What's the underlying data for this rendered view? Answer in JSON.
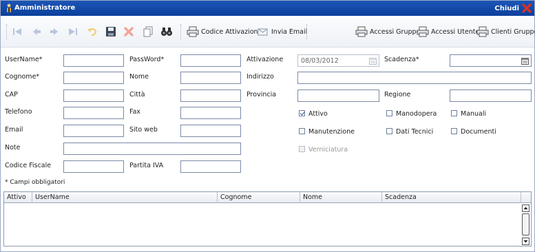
{
  "window": {
    "title": "Amministratore",
    "close_label": "Chiudi"
  },
  "toolbar": {
    "buttons": [
      {
        "icon": "first-record-icon"
      },
      {
        "icon": "previous-record-icon"
      },
      {
        "icon": "next-record-icon"
      },
      {
        "icon": "last-record-icon"
      },
      {
        "icon": "undo-icon"
      },
      {
        "icon": "save-icon"
      },
      {
        "icon": "delete-icon"
      },
      {
        "icon": "new-document-icon"
      },
      {
        "icon": "search-binoculars-icon"
      }
    ],
    "codice_attivazione": "Codice Attivazione",
    "invia_email": "Invia Email",
    "accessi_gruppo": "Accessi Gruppo",
    "accessi_utente": "Accessi Utente",
    "clienti_gruppo": "Clienti Gruppo"
  },
  "form": {
    "username_label": "UserName*",
    "password_label": "PassWord*",
    "attivazione_label": "Attivazione",
    "attivazione_value": "08/03/2012",
    "scadenza_label": "Scadenza*",
    "cognome_label": "Cognome*",
    "nome_label": "Nome",
    "indirizzo_label": "Indirizzo",
    "cap_label": "CAP",
    "citta_label": "Città",
    "provincia_label": "Provincia",
    "regione_label": "Regione",
    "telefono_label": "Telefono",
    "fax_label": "Fax",
    "email_label": "Email",
    "sito_web_label": "Sito web",
    "note_label": "Note",
    "codice_fiscale_label": "Codice Fiscale",
    "partita_iva_label": "Partita IVA",
    "required_note": "* Campi obbligatori"
  },
  "checkboxes": {
    "attivo": {
      "label": "Attivo",
      "checked": true
    },
    "manodopera": {
      "label": "Manodopera",
      "checked": false
    },
    "manuali": {
      "label": "Manuali",
      "checked": false
    },
    "manutenzione": {
      "label": "Manutenzione",
      "checked": false
    },
    "dati_tecnici": {
      "label": "Dati Tecnici",
      "checked": false
    },
    "documenti": {
      "label": "Documenti",
      "checked": false
    },
    "verniciatura": {
      "label": "Verniciatura",
      "checked": false,
      "disabled": true
    }
  },
  "grid": {
    "columns": [
      "Attivo",
      "UserName",
      "Cognome",
      "Nome",
      "Scadenza"
    ]
  },
  "colors": {
    "titlebar": "#0a3f9c",
    "close_x": "#e0301e",
    "input_border": "#7a8aa6"
  }
}
